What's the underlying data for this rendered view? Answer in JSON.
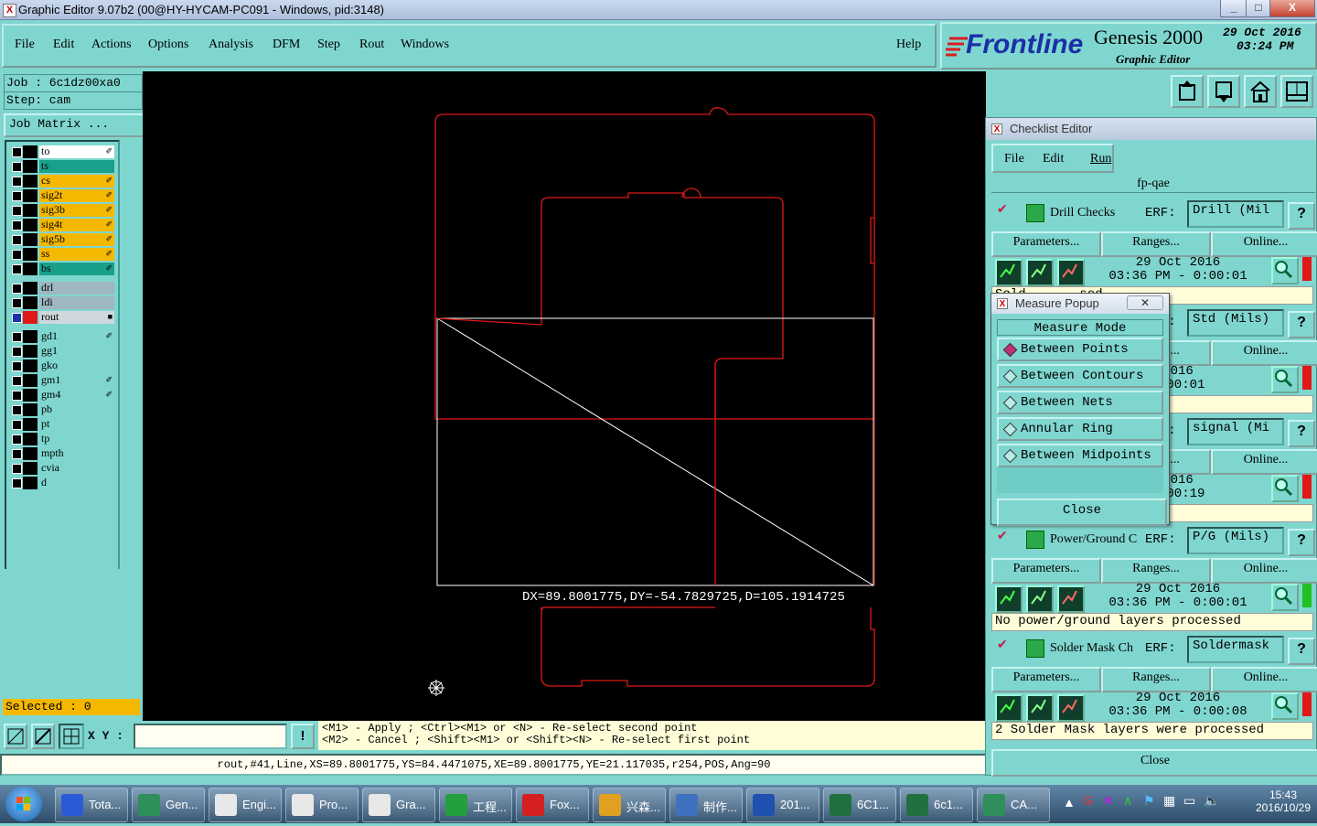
{
  "window": {
    "title": "Graphic Editor 9.07b2 (00@HY-HYCAM-PC091 - Windows, pid:3148)",
    "min": "_",
    "max": "□",
    "close": "X"
  },
  "menu": {
    "items": [
      "File",
      "Edit",
      "Actions",
      "Options",
      "Analysis",
      "DFM",
      "Step",
      "Rout",
      "Windows"
    ],
    "help": "Help"
  },
  "brand": {
    "logo": "Frontline",
    "product": "Genesis 2000",
    "subtitle": "Graphic Editor",
    "date": "29 Oct 2016",
    "time": "03:24 PM"
  },
  "job": {
    "job_label": "Job  : 6c1dz00xa0",
    "step_label": "Step: cam",
    "matrix_button": "Job Matrix ..."
  },
  "layers": [
    {
      "name": "to",
      "color": "#ffffff",
      "marker": "✐"
    },
    {
      "name": "ts",
      "color": "#1aa08a",
      "marker": ""
    },
    {
      "name": "cs",
      "color": "#f5b800",
      "marker": "✐"
    },
    {
      "name": "sig2t",
      "color": "#f5b800",
      "marker": "✐"
    },
    {
      "name": "sig3b",
      "color": "#f5b800",
      "marker": "✐"
    },
    {
      "name": "sig4t",
      "color": "#f5b800",
      "marker": "✐"
    },
    {
      "name": "sig5b",
      "color": "#f5b800",
      "marker": "✐"
    },
    {
      "name": "ss",
      "color": "#f5b800",
      "marker": "✐"
    },
    {
      "name": "bs",
      "color": "#1aa08a",
      "marker": "✐"
    },
    {
      "name": "drl",
      "color": "#9fb7c0",
      "marker": ""
    },
    {
      "name": "ldi",
      "color": "#9fb7c0",
      "marker": ""
    },
    {
      "name": "rout",
      "color": "#cfd8dc",
      "marker": "■"
    },
    {
      "name": "gd1",
      "color": "#7fd6cf",
      "marker": "✐"
    },
    {
      "name": "gg1",
      "color": "#7fd6cf",
      "marker": ""
    },
    {
      "name": "gko",
      "color": "#7fd6cf",
      "marker": ""
    },
    {
      "name": "gm1",
      "color": "#7fd6cf",
      "marker": "✐"
    },
    {
      "name": "gm4",
      "color": "#7fd6cf",
      "marker": "✐"
    },
    {
      "name": "pb",
      "color": "#7fd6cf",
      "marker": ""
    },
    {
      "name": "pt",
      "color": "#7fd6cf",
      "marker": ""
    },
    {
      "name": "tp",
      "color": "#7fd6cf",
      "marker": ""
    },
    {
      "name": "mpth",
      "color": "#7fd6cf",
      "marker": ""
    },
    {
      "name": "cvia",
      "color": "#7fd6cf",
      "marker": ""
    },
    {
      "name": "d",
      "color": "#7fd6cf",
      "marker": ""
    }
  ],
  "selected": "Selected : 0",
  "measure_readout": "DX=89.8001775,DY=-54.7829725,D=105.1914725",
  "xy_label": "X Y :",
  "hints": {
    "line1": "<M1> - Apply  ; <Ctrl><M1> or <N> - Re-select second point",
    "line2": "<M2> - Cancel ; <Shift><M1> or <Shift><N> - Re-select first point"
  },
  "status_line": "rout,#41,Line,XS=89.8001775,YS=84.4471075,XE=89.8001775,YE=21.117035,r254,POS,Ang=90",
  "checklist": {
    "title": "Checklist Editor",
    "menu": [
      "File",
      "Edit",
      "Run"
    ],
    "name": "fp-qae",
    "erf_label": "ERF:",
    "buttons": {
      "parameters": "Parameters...",
      "ranges": "Ranges...",
      "online": "Online..."
    },
    "help": "?",
    "close": "Close",
    "checks": [
      {
        "name": "Drill Checks",
        "erf": "Drill (Mil",
        "date": "29 Oct 2016",
        "time": "03:36 PM - 0:00:01",
        "message": "Sold...   ...sed",
        "flag": "#e01818"
      },
      {
        "name": "",
        "erf": "Std (Mils)",
        "date": "2016",
        "time": "0:00:01",
        "message": "",
        "flag": "#e01818"
      },
      {
        "name": "",
        "erf": "signal (Mi",
        "date": "2016",
        "time": "0:00:19",
        "message": "ed",
        "flag": "#e01818"
      },
      {
        "name": "Power/Ground C",
        "erf": "P/G (Mils)",
        "date": "29 Oct 2016",
        "time": "03:36 PM - 0:00:01",
        "message": "No power/ground layers processed",
        "flag": "#20c020"
      },
      {
        "name": "Solder Mask Ch",
        "erf": "Soldermask",
        "date": "29 Oct 2016",
        "time": "03:36 PM - 0:00:08",
        "message": "2 Solder Mask layers were processed",
        "flag": "#e01818"
      }
    ]
  },
  "measure_popup": {
    "title": "Measure Popup",
    "header": "Measure Mode",
    "options": [
      "Between Points",
      "Between Contours",
      "Between Nets",
      "Annular Ring",
      "Between Midpoints"
    ],
    "selected": 0,
    "close": "Close"
  },
  "taskbar": {
    "items": [
      {
        "label": "Tota...",
        "color": "#2a5bd7"
      },
      {
        "label": "Gen...",
        "color": "#2f8f5a"
      },
      {
        "label": "Engi...",
        "color": "#e8e8e8"
      },
      {
        "label": "Pro...",
        "color": "#e8e8e8"
      },
      {
        "label": "Gra...",
        "color": "#e8e8e8"
      },
      {
        "label": "工程...",
        "color": "#22a040"
      },
      {
        "label": "Fox...",
        "color": "#d42020"
      },
      {
        "label": "兴森...",
        "color": "#e0a020"
      },
      {
        "label": "制作...",
        "color": "#4070c0"
      },
      {
        "label": "201...",
        "color": "#2050b0"
      },
      {
        "label": "6C1...",
        "color": "#207040"
      },
      {
        "label": "6c1...",
        "color": "#207040"
      },
      {
        "label": "CA...",
        "color": "#2f8f5a"
      }
    ],
    "clock_time": "15:43",
    "clock_date": "2016/10/29"
  }
}
